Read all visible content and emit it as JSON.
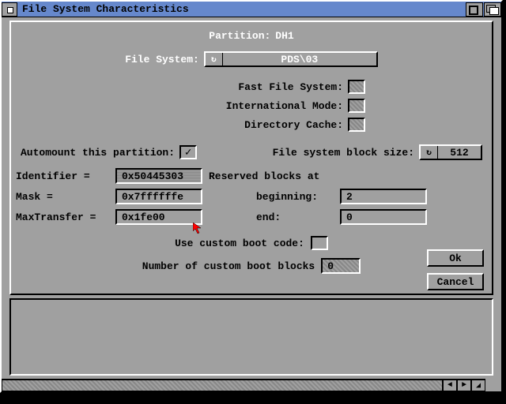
{
  "window": {
    "title": "File System Characteristics"
  },
  "partition": {
    "label": "Partition:",
    "value": "DH1"
  },
  "filesystem": {
    "label": "File System:",
    "value": "PDS\\03"
  },
  "options": {
    "fast_fs": {
      "label": "Fast File System:"
    },
    "intl_mode": {
      "label": "International Mode:"
    },
    "dir_cache": {
      "label": "Directory Cache:"
    }
  },
  "automount": {
    "label": "Automount this partition:",
    "checked": "✓"
  },
  "blocksize": {
    "label": "File system block size:",
    "value": "512"
  },
  "identifier": {
    "label": "Identifier =",
    "value": "0x50445303"
  },
  "mask": {
    "label": "Mask =",
    "value": "0x7ffffffe"
  },
  "maxtransfer": {
    "label": "MaxTransfer =",
    "value": "0x1fe00"
  },
  "reserved": {
    "header": "Reserved blocks at",
    "begin_label": "beginning:",
    "begin_value": "2",
    "end_label": "end:",
    "end_value": "0"
  },
  "customboot": {
    "use_label": "Use custom boot code:",
    "num_label": "Number of custom boot blocks",
    "num_value": "0"
  },
  "buttons": {
    "ok": "Ok",
    "cancel": "Cancel"
  }
}
